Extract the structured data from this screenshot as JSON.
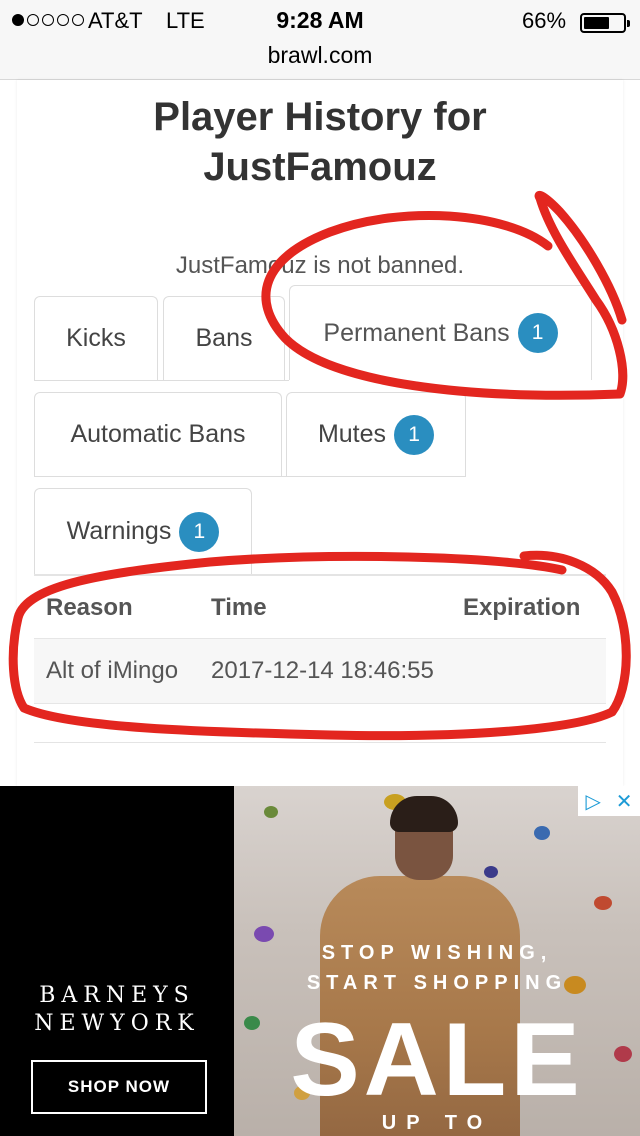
{
  "status_bar": {
    "carrier": "AT&T",
    "network": "LTE",
    "time": "9:28 AM",
    "battery_pct": "66%",
    "battery_level": 0.66,
    "signal_bars_filled": 1,
    "url": "brawl.com"
  },
  "page": {
    "title": "Player History for JustFamouz",
    "status_message": "JustFamouz is not banned."
  },
  "tabs": [
    {
      "label": "Kicks",
      "badge": null
    },
    {
      "label": "Bans",
      "badge": null
    },
    {
      "label": "Permanent Bans",
      "badge": "1"
    },
    {
      "label": "Automatic Bans",
      "badge": null
    },
    {
      "label": "Mutes",
      "badge": "1"
    },
    {
      "label": "Warnings",
      "badge": "1"
    }
  ],
  "table": {
    "headers": [
      "Reason",
      "Time",
      "Expiration"
    ],
    "rows": [
      [
        "Alt of iMingo",
        "2017-12-14 18:46:55",
        ""
      ]
    ]
  },
  "ad": {
    "brand_line1": "BARNEYS",
    "brand_line2": "NEWYORK",
    "shop_button": "SHOP NOW",
    "tagline1": "STOP WISHING,",
    "tagline2": "START SHOPPING",
    "headline": "SALE",
    "subline": "UP TO",
    "adchoices_icon": "adchoices-icon",
    "close_icon": "close-icon"
  },
  "colors": {
    "badge": "#2a8ec0",
    "annotation": "#e3261f"
  }
}
